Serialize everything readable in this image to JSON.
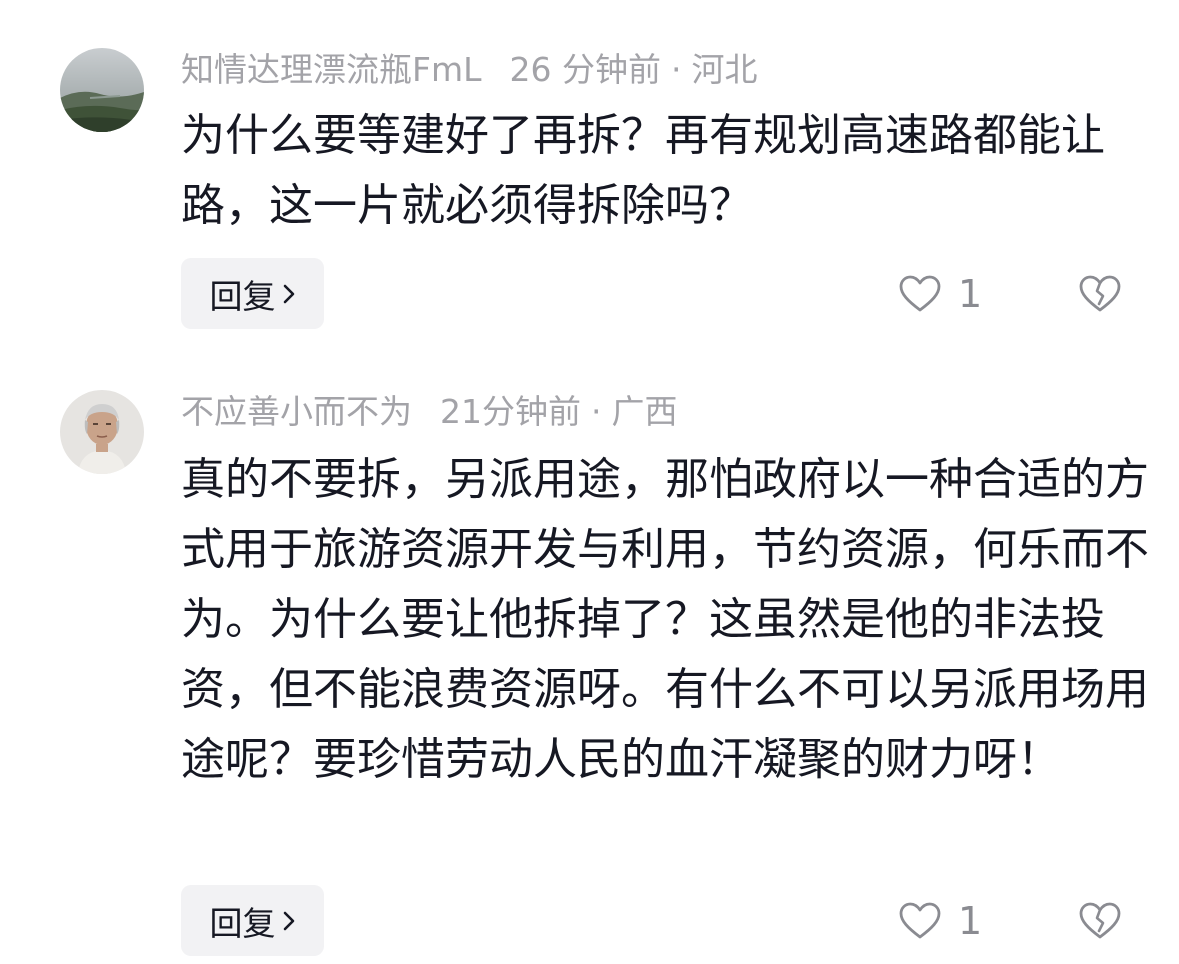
{
  "comments": [
    {
      "username": "知情达理漂流瓶FmL",
      "time": "26 分钟前",
      "separator": "·",
      "location": "河北",
      "text": "为什么要等建好了再拆？再有规划高速路都能让路，这一片就必须得拆除吗？",
      "reply_label": "回复",
      "like_count": "1"
    },
    {
      "username": "不应善小而不为",
      "time": "21分钟前",
      "separator": "·",
      "location": "广西",
      "text": "真的不要拆，另派用途，那怕政府以一种合适的方式用于旅游资源开发与利用，节约资源，何乐而不为。为什么要让他拆掉了？这虽然是他的非法投资，但不能浪费资源呀。有什么不可以另派用场用途呢？要珍惜劳动人民的血汗凝聚的财力呀！",
      "reply_label": "回复",
      "like_count": "1"
    }
  ],
  "colors": {
    "meta_text": "#a3a3a8",
    "body_text": "#161823",
    "reply_bg": "#f2f2f4",
    "icon": "#8a8b91"
  },
  "icons": [
    "heart-outline-icon",
    "broken-heart-icon",
    "chevron-right-icon"
  ]
}
